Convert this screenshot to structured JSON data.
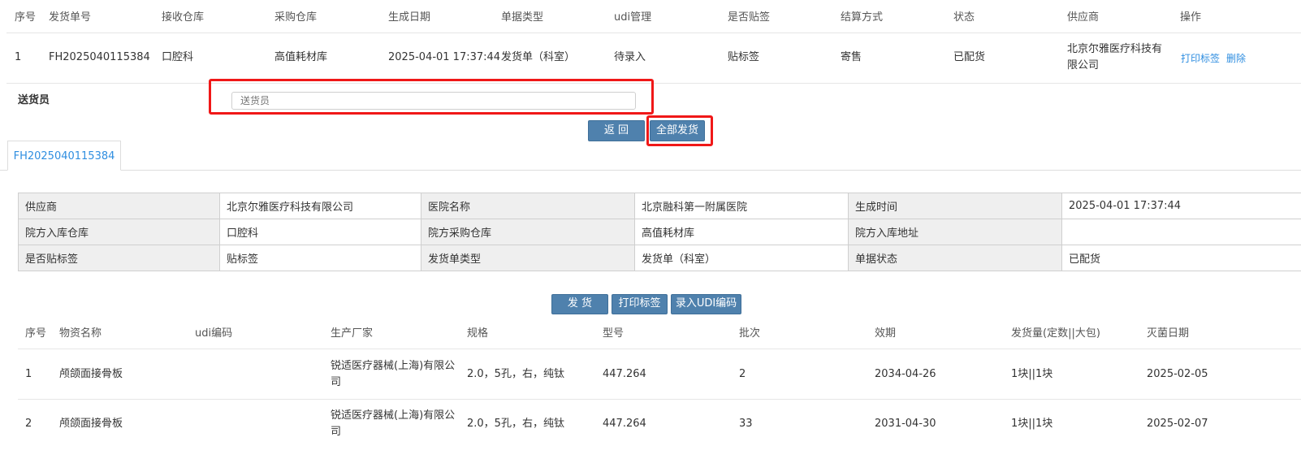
{
  "order_table": {
    "headers": [
      "序号",
      "发货单号",
      "接收仓库",
      "采购仓库",
      "生成日期",
      "单据类型",
      "udi管理",
      "是否贴签",
      "结算方式",
      "状态",
      "供应商",
      "操作"
    ],
    "row": {
      "index": "1",
      "order_no": "FH2025040115384",
      "receive_wh": "口腔科",
      "purchase_wh": "高值耗材库",
      "date": "2025-04-01 17:37:44",
      "doc_type": "发货单（科室）",
      "udi": "待录入",
      "label": "贴标签",
      "settle": "寄售",
      "status": "已配货",
      "supplier_line1": "北京尔雅医疗科技有",
      "supplier_line2": "限公司",
      "action_print": "打印标签",
      "action_delete": "删除"
    }
  },
  "delivery": {
    "label": "送货员",
    "placeholder": "送货员"
  },
  "buttons": {
    "back": "返 回",
    "ship_all": "全部发货",
    "ship": "发 货",
    "print_label": "打印标签",
    "enter_udi": "录入UDI编码"
  },
  "tab": {
    "label": "FH2025040115384"
  },
  "info": {
    "supplier_label": "供应商",
    "supplier": "北京尔雅医疗科技有限公司",
    "hospital_label": "医院名称",
    "hospital": "北京融科第一附属医院",
    "created_label": "生成时间",
    "created": "2025-04-01 17:37:44",
    "in_wh_label": "院方入库仓库",
    "in_wh": "口腔科",
    "purchase_wh_label": "院方采购仓库",
    "purchase_wh": "高值耗材库",
    "in_addr_label": "院方入库地址",
    "in_addr": "",
    "label_flag_label": "是否贴标签",
    "label_flag": "贴标签",
    "doc_type_label": "发货单类型",
    "doc_type": "发货单（科室）",
    "doc_status_label": "单据状态",
    "doc_status": "已配货"
  },
  "items_table": {
    "headers": [
      "序号",
      "物资名称",
      "udi编码",
      "生产厂家",
      "规格",
      "型号",
      "批次",
      "效期",
      "发货量(定数||大包)",
      "灭菌日期"
    ],
    "rows": [
      {
        "index": "1",
        "name": "颅颌面接骨板",
        "udi": "",
        "maker_line1": "锐适医疗器械(上海)有限公",
        "maker_line2": "司",
        "spec": "2.0，5孔，右，纯钛",
        "model": "447.264",
        "batch": "2",
        "expiry": "2034-04-26",
        "qty": "1块||1块",
        "sterile": "2025-02-05"
      },
      {
        "index": "2",
        "name": "颅颌面接骨板",
        "udi": "",
        "maker_line1": "锐适医疗器械(上海)有限公",
        "maker_line2": "司",
        "spec": "2.0，5孔，右，纯钛",
        "model": "447.264",
        "batch": "33",
        "expiry": "2031-04-30",
        "qty": "1块||1块",
        "sterile": "2025-02-07"
      }
    ]
  },
  "colors": {
    "button": "#4f81ad",
    "link": "#2f8ee0",
    "highlight": "#f01818"
  }
}
